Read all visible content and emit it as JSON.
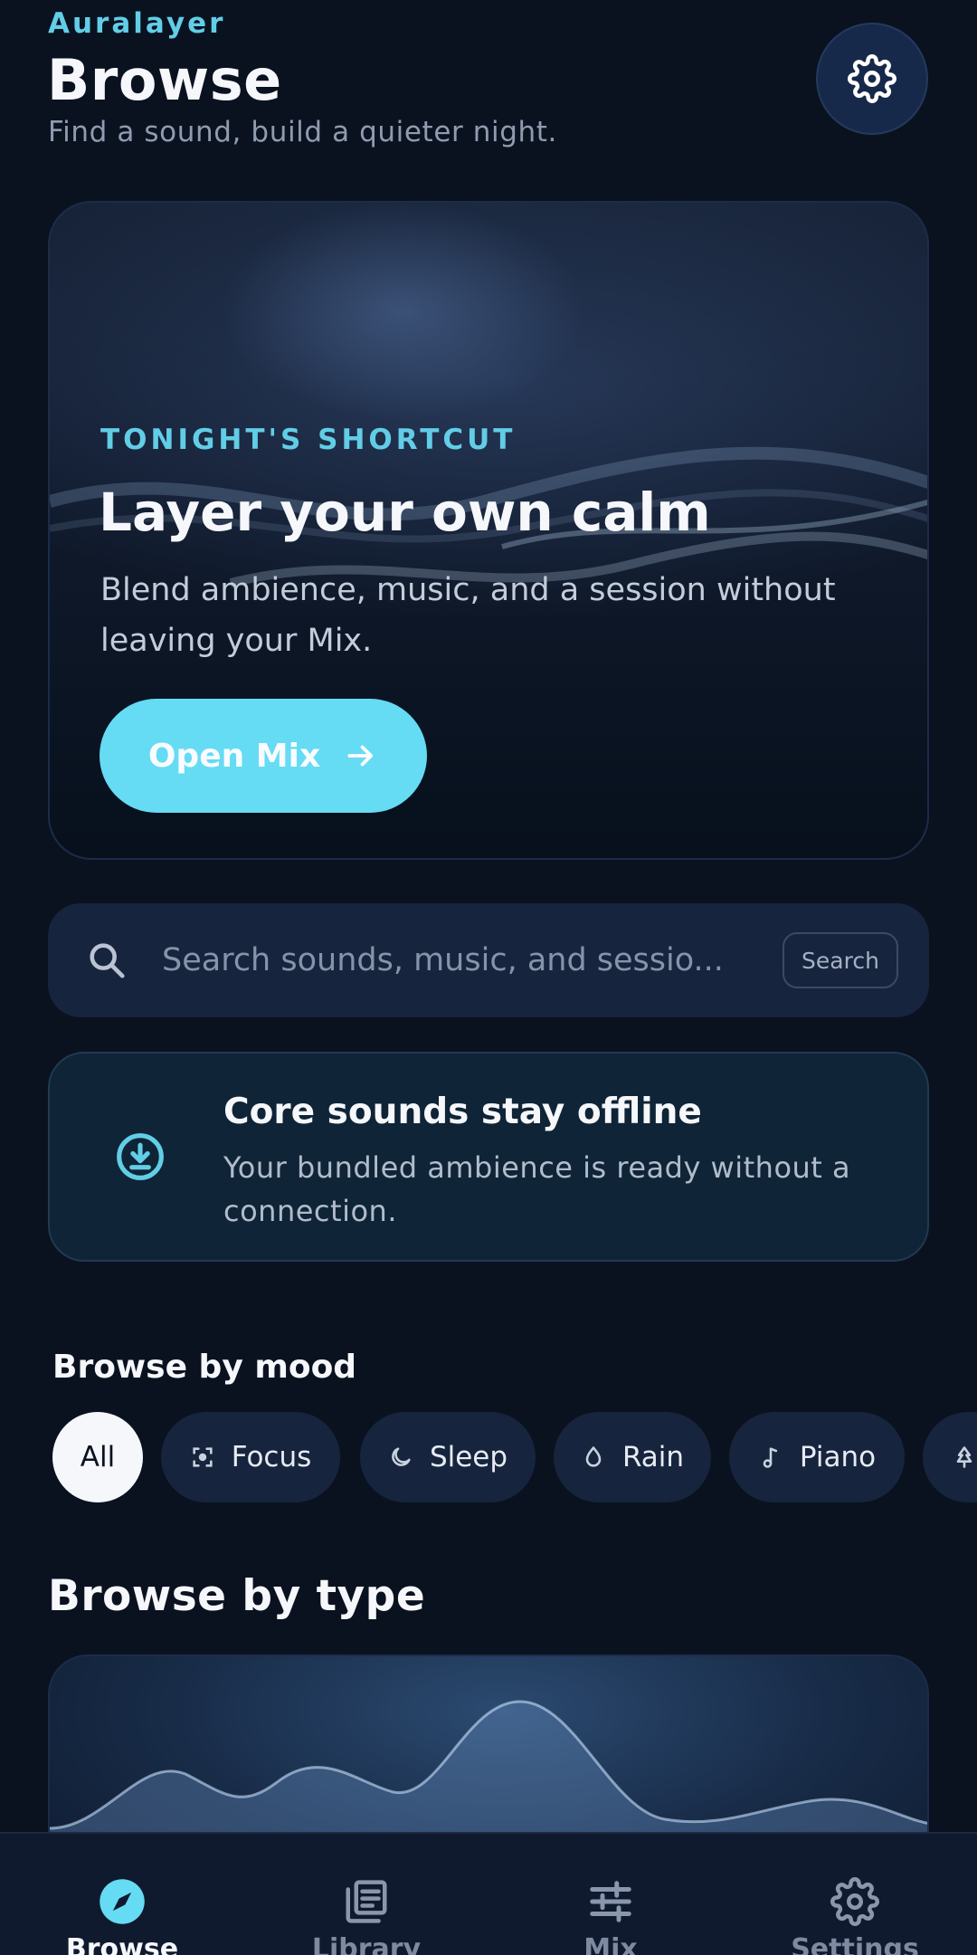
{
  "header": {
    "brand": "Auralayer",
    "title": "Browse",
    "subtitle": "Find a sound, build a quieter night."
  },
  "hero": {
    "kicker": "TONIGHT'S SHORTCUT",
    "title": "Layer your own calm",
    "body": "Blend ambience, music, and a session without leaving your Mix.",
    "button_label": "Open Mix"
  },
  "search": {
    "placeholder": "Search sounds, music, and sessio...",
    "button_label": "Search"
  },
  "offline_card": {
    "title": "Core sounds stay offline",
    "body": "Your bundled ambience is ready without a connection."
  },
  "mood": {
    "title": "Browse by mood",
    "chips": [
      {
        "label": "All",
        "icon": null,
        "active": true
      },
      {
        "label": "Focus",
        "icon": "focus-icon",
        "active": false
      },
      {
        "label": "Sleep",
        "icon": "moon-icon",
        "active": false
      },
      {
        "label": "Rain",
        "icon": "droplet-icon",
        "active": false
      },
      {
        "label": "Piano",
        "icon": "music-note-icon",
        "active": false
      },
      {
        "label": "",
        "icon": "tree-icon",
        "active": false
      }
    ]
  },
  "type_section": {
    "title": "Browse by type"
  },
  "bottom_nav": {
    "items": [
      {
        "label": "Browse",
        "icon": "compass-icon",
        "active": true
      },
      {
        "label": "Library",
        "icon": "library-icon",
        "active": false
      },
      {
        "label": "Mix",
        "icon": "sliders-icon",
        "active": false
      },
      {
        "label": "Settings",
        "icon": "gear-icon",
        "active": false
      }
    ]
  },
  "colors": {
    "background": "#0a1220",
    "accent": "#62cde6",
    "button": "#66dbf4",
    "surface": "#17243d"
  }
}
